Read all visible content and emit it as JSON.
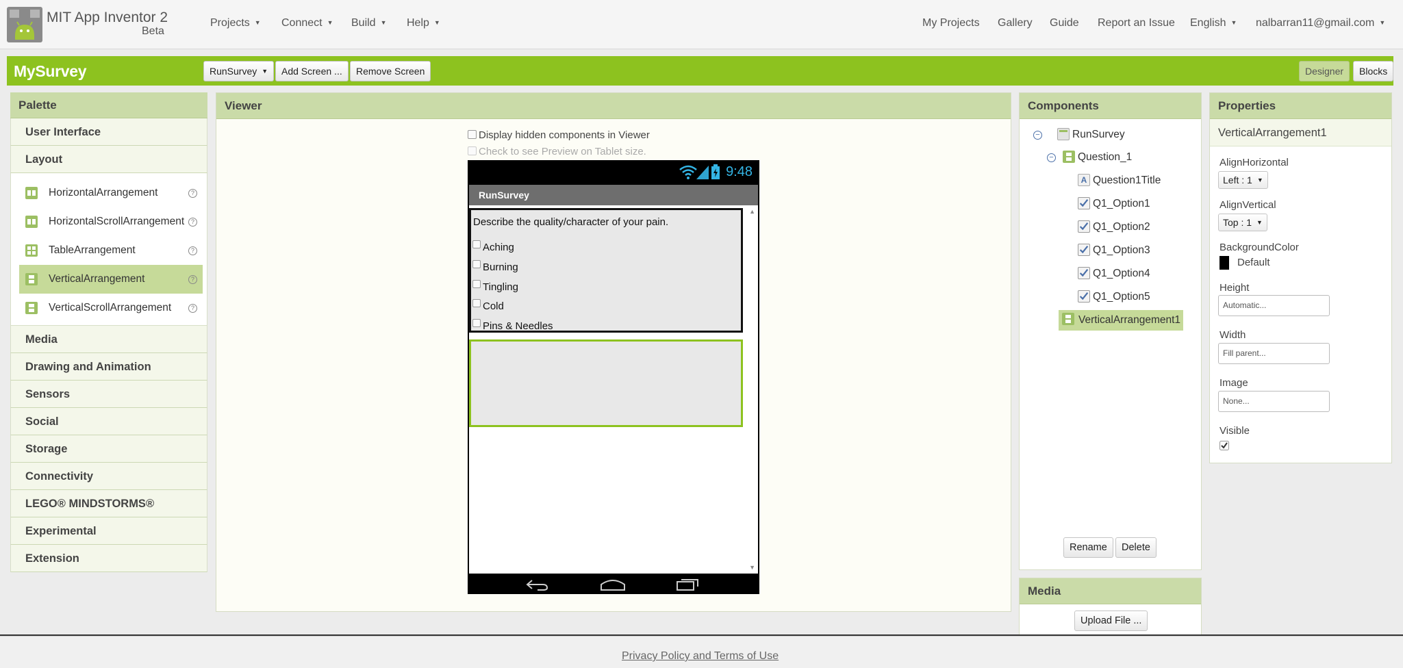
{
  "header": {
    "brand": "MIT App Inventor 2",
    "brand_sub": "Beta",
    "menus": [
      "Projects",
      "Connect",
      "Build",
      "Help"
    ],
    "links": [
      "My Projects",
      "Gallery",
      "Guide",
      "Report an Issue"
    ],
    "language": "English",
    "user": "nalbarran11@gmail.com"
  },
  "toolbar": {
    "project_name": "MySurvey",
    "screen_select": "RunSurvey",
    "add_screen": "Add Screen ...",
    "remove_screen": "Remove Screen",
    "designer": "Designer",
    "blocks": "Blocks"
  },
  "palette": {
    "title": "Palette",
    "sections_top": [
      "User Interface",
      "Layout"
    ],
    "layout_items": [
      "HorizontalArrangement",
      "HorizontalScrollArrangement",
      "TableArrangement",
      "VerticalArrangement",
      "VerticalScrollArrangement"
    ],
    "selected_item": "VerticalArrangement",
    "help_glyph": "?",
    "sections_bottom": [
      "Media",
      "Drawing and Animation",
      "Sensors",
      "Social",
      "Storage",
      "Connectivity",
      "LEGO® MINDSTORMS®",
      "Experimental",
      "Extension"
    ]
  },
  "viewer": {
    "title": "Viewer",
    "hidden_components": "Display hidden components in Viewer",
    "tablet_preview": "Check to see Preview on Tablet size.",
    "phone": {
      "clock": "9:48",
      "app_title": "RunSurvey",
      "question": "Describe the quality/character of your pain.",
      "options": [
        "Aching",
        "Burning",
        "Tingling",
        "Cold",
        "Pins & Needles"
      ]
    }
  },
  "components": {
    "title": "Components",
    "tree": {
      "root": "RunSurvey",
      "group": "Question_1",
      "title_label": "Question1Title",
      "options": [
        "Q1_Option1",
        "Q1_Option2",
        "Q1_Option3",
        "Q1_Option4",
        "Q1_Option5"
      ],
      "selected": "VerticalArrangement1"
    },
    "rename": "Rename",
    "delete": "Delete"
  },
  "media": {
    "title": "Media",
    "upload": "Upload File ..."
  },
  "properties": {
    "title": "Properties",
    "component": "VerticalArrangement1",
    "align_horizontal_label": "AlignHorizontal",
    "align_horizontal_value": "Left : 1",
    "align_vertical_label": "AlignVertical",
    "align_vertical_value": "Top : 1",
    "background_color_label": "BackgroundColor",
    "background_color_value": "Default",
    "height_label": "Height",
    "height_value": "Automatic...",
    "width_label": "Width",
    "width_value": "Fill parent...",
    "image_label": "Image",
    "image_value": "None...",
    "visible_label": "Visible",
    "visible_checked": true
  },
  "footer": {
    "privacy": "Privacy Policy and Terms of Use"
  },
  "colors": {
    "accent_green": "#8dc21f",
    "panel_header": "#cadba8",
    "selected": "#c6da99",
    "clock_blue": "#34b5e5"
  }
}
